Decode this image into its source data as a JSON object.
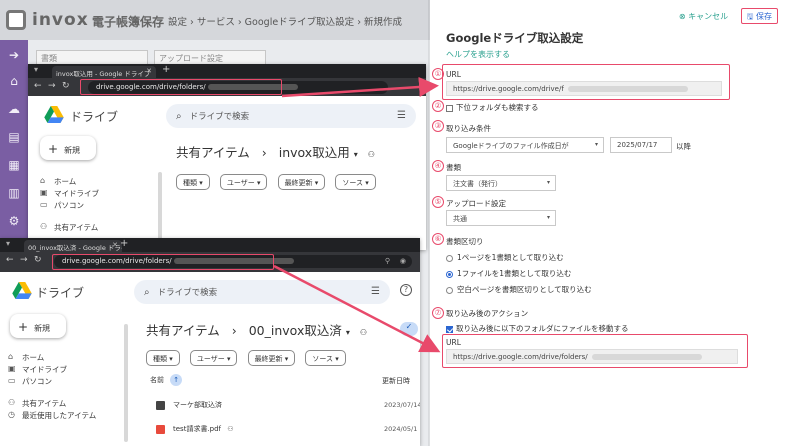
{
  "app": {
    "logo_text": "invox",
    "logo_sub": "電子帳簿保存",
    "breadcrumb": "設定 › サービス › Googleドライブ取込設定 › 新規作成",
    "select_doc": "書類",
    "select_upload": "アップロード設定"
  },
  "browser1": {
    "tab_title": "invox取込用 - Google ドライブ",
    "url": "drive.google.com/drive/folders/",
    "drive_title": "ドライブ",
    "search_placeholder": "ドライブで検索",
    "new_label": "新規",
    "nav": [
      "ホーム",
      "マイドライブ",
      "パソコン",
      "共有アイテム"
    ],
    "crumb_root": "共有アイテム",
    "crumb_sep": "›",
    "crumb_folder": "invox取込用",
    "chips": [
      "種類",
      "ユーザー",
      "最終更新",
      "ソース"
    ]
  },
  "browser2": {
    "tab_title": "00_invox取込済 - Google ドライブ",
    "url": "drive.google.com/drive/folders/",
    "drive_title": "ドライブ",
    "search_placeholder": "ドライブで検索",
    "new_label": "新規",
    "nav": [
      "ホーム",
      "マイドライブ",
      "パソコン",
      "共有アイテム",
      "最近使用したアイテム"
    ],
    "crumb_root": "共有アイテム",
    "crumb_sep": "›",
    "crumb_folder": "00_invox取込済",
    "chips": [
      "種類",
      "ユーザー",
      "最終更新",
      "ソース"
    ],
    "col_name": "名前",
    "col_updated": "更新日時",
    "files": [
      {
        "name": "マーケ部取込済",
        "date": "2023/07/14"
      },
      {
        "name": "test請求書.pdf",
        "date": "2024/05/1"
      }
    ]
  },
  "panel": {
    "cancel": "キャンセル",
    "save": "保存",
    "title": "Googleドライブ取込設定",
    "help": "ヘルプを表示する",
    "markers": [
      "①",
      "②",
      "③",
      "④",
      "⑤",
      "⑥",
      "⑦"
    ],
    "url_label": "URL",
    "url_value": "https://drive.google.com/drive/f",
    "subfolder_label": "下位フォルダも検索する",
    "condition_label": "取り込み条件",
    "condition_select": "Googleドライブのファイル作成日が",
    "condition_date": "2025/07/17",
    "condition_suffix": "以降",
    "doc_label": "書類",
    "doc_value": "注文書（発行）",
    "upload_label": "アップロード設定",
    "upload_value": "共通",
    "split_label": "書類区切り",
    "split_options": [
      "1ページを1書類として取り込む",
      "1ファイルを1書類として取り込む",
      "空白ページを書類区切りとして取り込む"
    ],
    "split_selected": 1,
    "action_label": "取り込み後のアクション",
    "move_label": "取り込み後に以下のフォルダにファイルを移動する",
    "move_url_label": "URL",
    "move_url_value": "https://drive.google.com/drive/folders/"
  },
  "colors": {
    "accent_teal": "#29a08e",
    "highlight_red": "#e84a6b",
    "sidebar_purple": "#7a5ea3",
    "link_blue": "#2b66d1"
  }
}
